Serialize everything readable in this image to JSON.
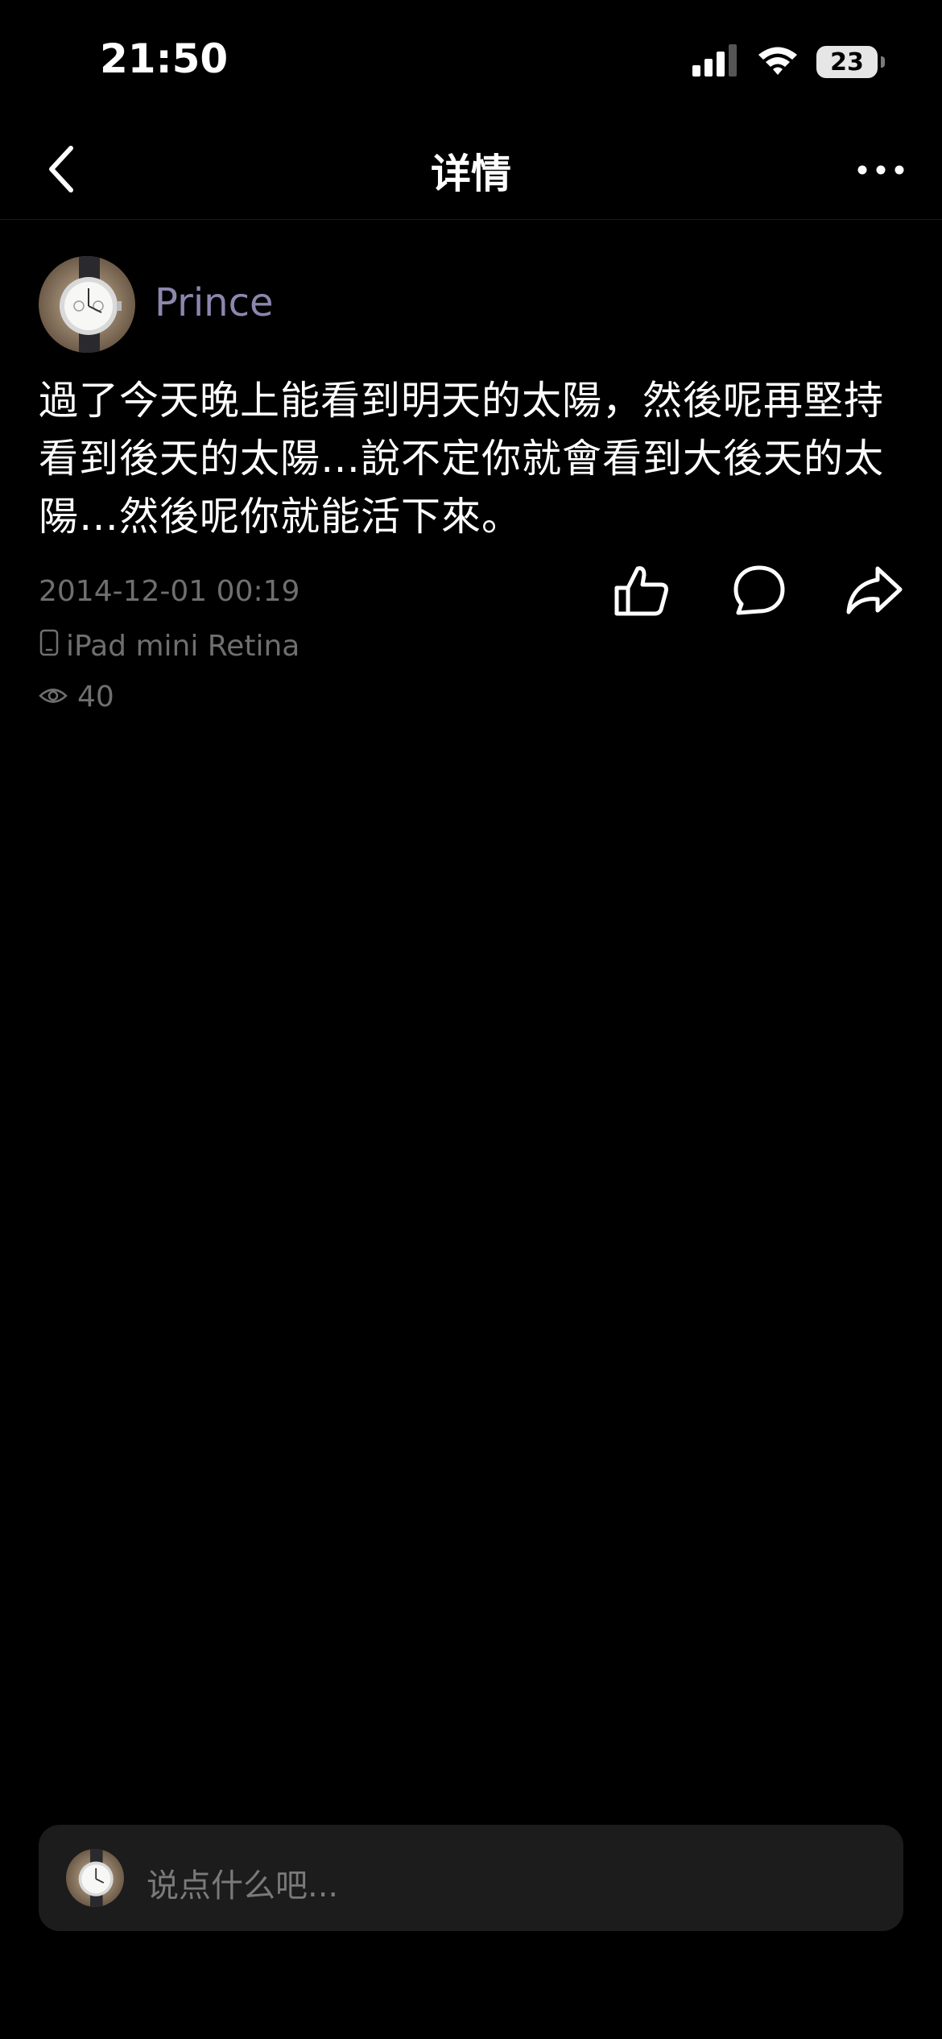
{
  "status_bar": {
    "time": "21:50",
    "battery": "23",
    "icons": [
      "signal-icon",
      "wifi-icon",
      "battery-icon"
    ]
  },
  "nav": {
    "title": "详情",
    "back_icon": "chevron-left-icon",
    "more_icon": "more-dots-icon"
  },
  "post": {
    "author": "Prince",
    "lines": [
      "過了今天晚上能看到明天的太陽，然後呢再堅持",
      "看到後天的太陽…說不定你就會看到大後天的太",
      "陽…然後呢你就能活下來。"
    ],
    "timestamp": "2014-12-01 00:19",
    "device": "iPad mini Retina",
    "views": "40",
    "actions": [
      "like-icon",
      "comment-icon",
      "share-icon"
    ]
  },
  "comment_bar": {
    "placeholder": "说点什么吧..."
  },
  "colors": {
    "background": "#000000",
    "username": "#8d86ad",
    "meta_text": "#6f6f6f",
    "comment_bar_bg": "#1c1c1c"
  }
}
